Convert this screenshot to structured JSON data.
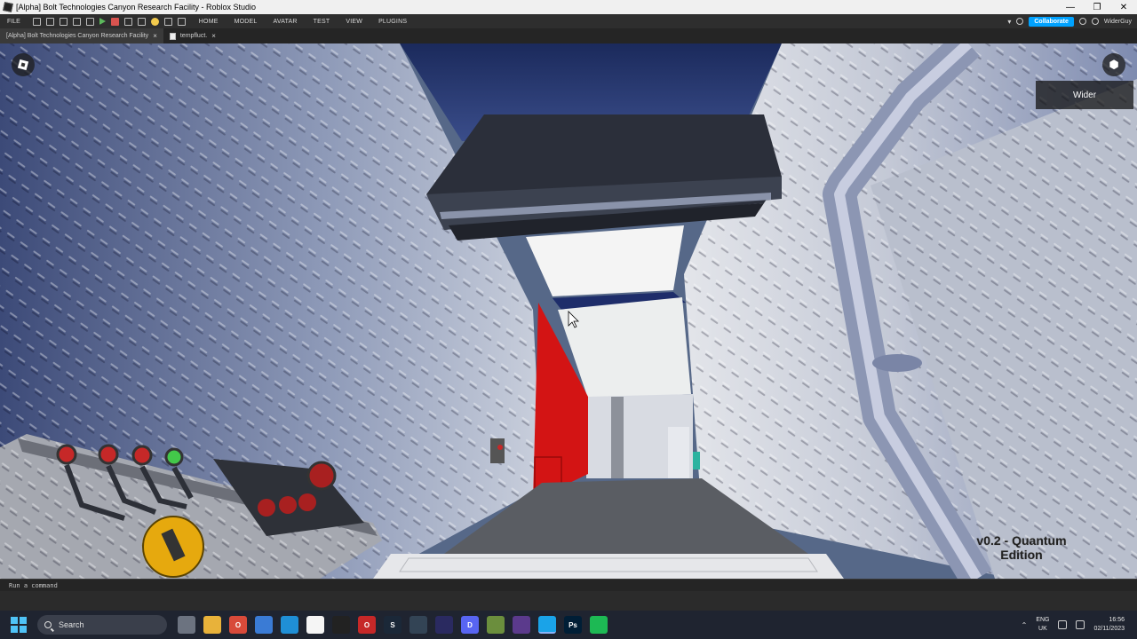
{
  "window": {
    "title": "[Alpha] Bolt Technologies Canyon Research Facility - Roblox Studio"
  },
  "menubar": {
    "file": "FILE",
    "tabs": [
      "HOME",
      "MODEL",
      "AVATAR",
      "TEST",
      "VIEW",
      "PLUGINS"
    ],
    "collaborate": "Collaborate",
    "user": "WiderGuy"
  },
  "doc_tabs": [
    {
      "label": "[Alpha] Bolt Technologies Canyon Research Facility",
      "close": "×"
    },
    {
      "label": "tempfluct.",
      "close": "×"
    }
  ],
  "viewport": {
    "player_name": "Wider",
    "version_line1": "v0.2 - Quantum",
    "version_line2": "Edition",
    "panel_label": "≡III"
  },
  "command_bar": {
    "placeholder": "Run a command"
  },
  "taskbar": {
    "search_label": "Search",
    "apps": [
      {
        "icon": "task-view-icon",
        "color": "#6c7380",
        "glyph": ""
      },
      {
        "icon": "file-explorer-icon",
        "color": "#e8b23a",
        "glyph": ""
      },
      {
        "icon": "opera-gx-icon",
        "color": "#d84a3a",
        "glyph": "O"
      },
      {
        "icon": "microsoft-store-icon",
        "color": "#3a7bd5",
        "glyph": ""
      },
      {
        "icon": "roblox-studio-icon",
        "color": "#1f8fd6",
        "glyph": ""
      },
      {
        "icon": "notepad-icon",
        "color": "#f5f5f5",
        "glyph": ""
      },
      {
        "icon": "dark-app-icon",
        "color": "#222222",
        "glyph": ""
      },
      {
        "icon": "opera-icon",
        "color": "#c62828",
        "glyph": "O"
      },
      {
        "icon": "steam-icon",
        "color": "#1b2838",
        "glyph": "S"
      },
      {
        "icon": "davinci-icon",
        "color": "#334455",
        "glyph": ""
      },
      {
        "icon": "stellarium-icon",
        "color": "#2a2a60",
        "glyph": ""
      },
      {
        "icon": "discord-icon",
        "color": "#5865f2",
        "glyph": "D"
      },
      {
        "icon": "minecraft-icon",
        "color": "#6b8e3d",
        "glyph": ""
      },
      {
        "icon": "aseprite-icon",
        "color": "#5b3a8c",
        "glyph": ""
      },
      {
        "icon": "roblox-studio-active-icon",
        "color": "#1aa3e8",
        "glyph": ""
      },
      {
        "icon": "photoshop-icon",
        "color": "#001e36",
        "glyph": "Ps"
      },
      {
        "icon": "spotify-icon",
        "color": "#1db954",
        "glyph": ""
      }
    ],
    "language_line1": "ENG",
    "language_line2": "UK",
    "time": "16:56",
    "date": "02/11/2023"
  },
  "colors": {
    "accent": "#00a2ff",
    "red_wall": "#d31414",
    "floor": "#5a5d63"
  }
}
